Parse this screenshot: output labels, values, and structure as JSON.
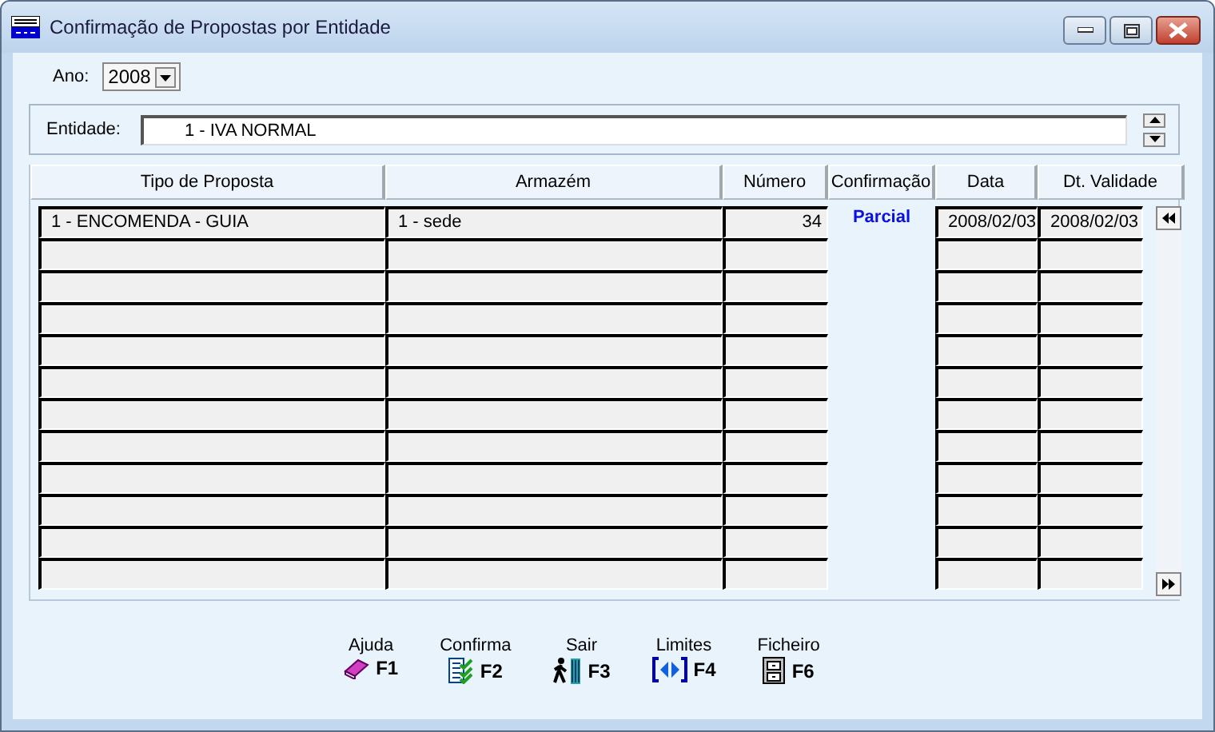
{
  "window": {
    "title": "Confirmação de Propostas por Entidade"
  },
  "ano": {
    "label": "Ano:",
    "value": "2008"
  },
  "entidade": {
    "label": "Entidade:",
    "value": "1 - IVA NORMAL"
  },
  "table": {
    "columns": [
      "Tipo de Proposta",
      "Armazém",
      "Número",
      "Confirmação",
      "Data",
      "Dt. Validade"
    ],
    "rows": [
      {
        "tipo": "1 - ENCOMENDA - GUIA",
        "armazem": "1 - sede",
        "numero": "34",
        "confirmacao": "Parcial",
        "data": "2008/02/03",
        "validade": "2008/02/03"
      }
    ]
  },
  "function_keys": [
    {
      "kind": "help",
      "label": "Ajuda",
      "key": "F1"
    },
    {
      "kind": "confirm",
      "label": "Confirma",
      "key": "F2"
    },
    {
      "kind": "exit",
      "label": "Sair",
      "key": "F3"
    },
    {
      "kind": "limits",
      "label": "Limites",
      "key": "F4"
    },
    {
      "kind": "file",
      "label": "Ficheiro",
      "key": "F6"
    }
  ]
}
